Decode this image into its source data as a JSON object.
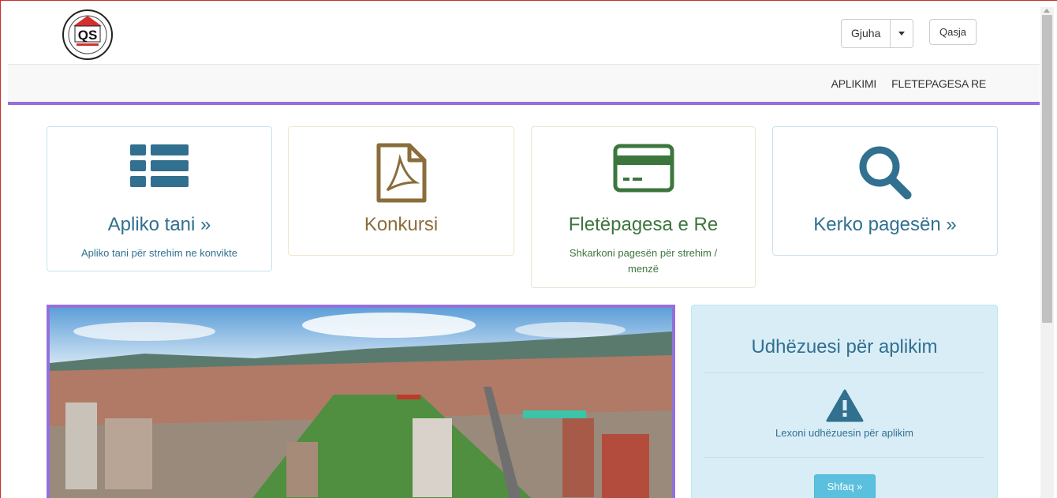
{
  "header": {
    "logo_text": "QS",
    "language_label": "Gjuha",
    "login_label": "Qasja"
  },
  "nav": {
    "links": [
      "APLIKIMI",
      "FLETEPAGESA RE"
    ]
  },
  "tiles": [
    {
      "title": "Apliko tani »",
      "subtitle": "Apliko tani për strehim ne konvikte",
      "icon": "list-icon",
      "color": "#31708f"
    },
    {
      "title": "Konkursi",
      "subtitle": "",
      "icon": "pdf-file-icon",
      "color": "#8a6d3b"
    },
    {
      "title": "Fletëpagesa e Re",
      "subtitle": "Shkarkoni pagesën për strehim / menzë",
      "icon": "credit-card-icon",
      "color": "#3c763d"
    },
    {
      "title": "Kerko pagesën »",
      "subtitle": "",
      "icon": "search-icon",
      "color": "#31708f"
    }
  ],
  "hero": {
    "image": "city-aerial-photo"
  },
  "guide": {
    "title": "Udhëzuesi për aplikim",
    "text": "Lexoni udhëzuesin për aplikim",
    "button": "Shfaq »",
    "icon": "warning-icon"
  },
  "colors": {
    "accent_purple": "#9370db",
    "info_blue": "#31708f",
    "info_bg": "#d9edf7",
    "button_info": "#5bc0de"
  }
}
